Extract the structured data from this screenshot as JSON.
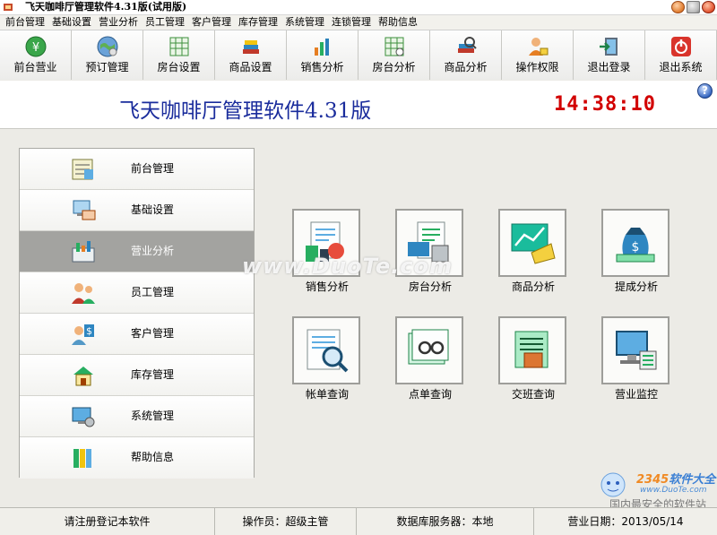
{
  "window": {
    "title": "飞天咖啡厅管理软件4.31版(试用版)"
  },
  "menubar": [
    "前台管理",
    "基础设置",
    "营业分析",
    "员工管理",
    "客户管理",
    "库存管理",
    "系统管理",
    "连锁管理",
    "帮助信息"
  ],
  "toolbar": [
    {
      "label": "前台营业",
      "icon": "front-desk-icon"
    },
    {
      "label": "预订管理",
      "icon": "booking-globe-icon"
    },
    {
      "label": "房台设置",
      "icon": "table-grid-icon"
    },
    {
      "label": "商品设置",
      "icon": "product-books-icon"
    },
    {
      "label": "销售分析",
      "icon": "sales-chart-icon"
    },
    {
      "label": "房台分析",
      "icon": "table-analysis-icon"
    },
    {
      "label": "商品分析",
      "icon": "product-analysis-icon"
    },
    {
      "label": "操作权限",
      "icon": "user-lock-icon"
    },
    {
      "label": "退出登录",
      "icon": "logout-door-icon"
    },
    {
      "label": "退出系统",
      "icon": "power-exit-icon"
    }
  ],
  "header": {
    "title": "飞天咖啡厅管理软件4.31版",
    "clock": "14:38:10"
  },
  "nav": {
    "active_index": 2,
    "items": [
      {
        "label": "前台管理",
        "icon": "front-manage-icon"
      },
      {
        "label": "基础设置",
        "icon": "basic-settings-icon"
      },
      {
        "label": "营业分析",
        "icon": "business-analysis-icon"
      },
      {
        "label": "员工管理",
        "icon": "staff-icon"
      },
      {
        "label": "客户管理",
        "icon": "customer-icon"
      },
      {
        "label": "库存管理",
        "icon": "inventory-icon"
      },
      {
        "label": "系统管理",
        "icon": "system-icon"
      },
      {
        "label": "帮助信息",
        "icon": "help-books-icon"
      }
    ]
  },
  "functions": [
    {
      "label": "销售分析",
      "icon": "sales-report-icon"
    },
    {
      "label": "房台分析",
      "icon": "table-report-icon"
    },
    {
      "label": "商品分析",
      "icon": "product-report-icon"
    },
    {
      "label": "提成分析",
      "icon": "commission-money-icon"
    },
    {
      "label": "帐单查询",
      "icon": "bill-search-icon"
    },
    {
      "label": "点单查询",
      "icon": "order-search-icon"
    },
    {
      "label": "交班查询",
      "icon": "shift-search-icon"
    },
    {
      "label": "营业监控",
      "icon": "business-monitor-icon"
    }
  ],
  "watermark": "www.DuoTe.com",
  "corner_watermark": {
    "brand_text": "2345",
    "brand_suffix": "软件大全",
    "url": "www.DuoTe.com",
    "caption": "国内最安全的软件站"
  },
  "statusbar": {
    "register": "请注册登记本软件",
    "operator": "操作员：超级主管",
    "db_server": "数据库服务器：本地",
    "business_date": "营业日期：2013/05/14"
  },
  "colors": {
    "title_blue": "#1a2c9c",
    "clock_red": "#d20000",
    "active_nav": "#a3a3a0"
  }
}
